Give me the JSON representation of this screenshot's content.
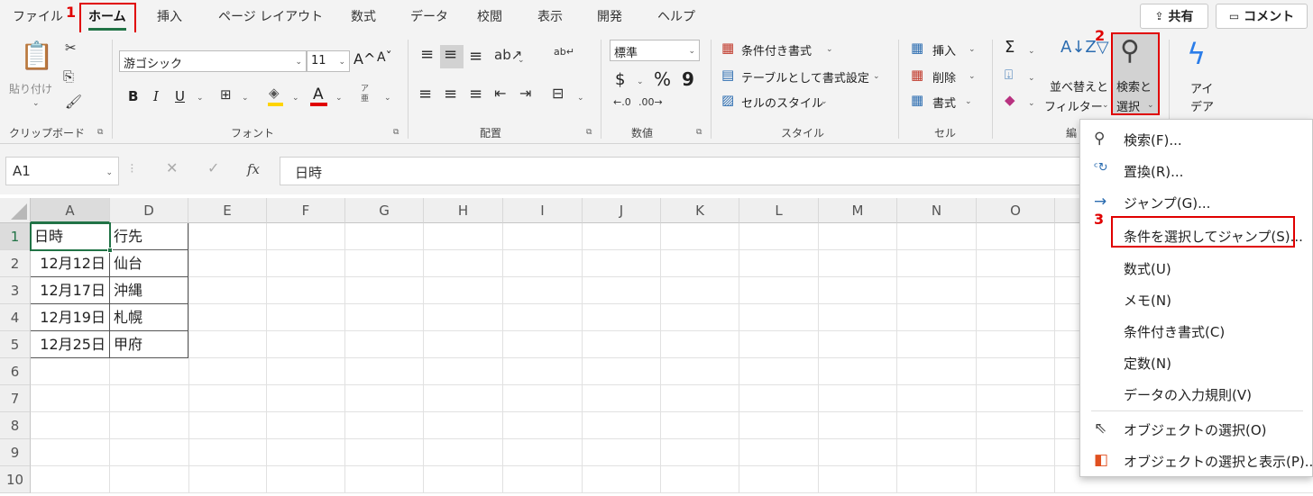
{
  "tabs": [
    {
      "label": "ファイル"
    },
    {
      "label": "ホーム"
    },
    {
      "label": "挿入"
    },
    {
      "label": "ページ レイアウト"
    },
    {
      "label": "数式"
    },
    {
      "label": "データ"
    },
    {
      "label": "校閲"
    },
    {
      "label": "表示"
    },
    {
      "label": "開発"
    },
    {
      "label": "ヘルプ"
    }
  ],
  "share_label": "共有",
  "comment_label": "コメント",
  "steps": {
    "s1": "1",
    "s2": "2",
    "s3": "3"
  },
  "ribbon": {
    "clipboard": {
      "paste": "貼り付け",
      "group": "クリップボード"
    },
    "font": {
      "name": "游ゴシック",
      "size": "11",
      "bold": "B",
      "italic": "I",
      "underline": "U",
      "font_color_glyph": "A",
      "grow": "A^",
      "shrink": "Aˇ",
      "phonetic": "ア亜",
      "group": "フォント"
    },
    "alignment": {
      "group": "配置",
      "wrap": "ab↵"
    },
    "number": {
      "format": "標準",
      "currency": "$",
      "percent": "%",
      "comma": "9",
      "group": "数値"
    },
    "styles": {
      "conditional": "条件付き書式",
      "table": "テーブルとして書式設定",
      "cell_style": "セルのスタイル",
      "group": "スタイル"
    },
    "cells": {
      "insert": "挿入",
      "delete": "削除",
      "format": "書式",
      "group": "セル"
    },
    "editing": {
      "sigma": "Σ",
      "sort_line1": "並べ替えと",
      "sort_line2": "フィルター",
      "find_line1": "検索と",
      "find_line2": "選択",
      "group_partial": "編"
    },
    "ideas": {
      "line1": "アイ",
      "line2": "デア"
    }
  },
  "formula_bar": {
    "name_box": "A1",
    "fx": "fx",
    "content": "日時"
  },
  "columns": [
    "A",
    "D",
    "E",
    "F",
    "G",
    "H",
    "I",
    "J",
    "K",
    "L",
    "M",
    "N",
    "O"
  ],
  "rows": [
    "1",
    "2",
    "3",
    "4",
    "5",
    "6",
    "7",
    "8",
    "9",
    "10"
  ],
  "table": [
    {
      "a": "日時",
      "d": "行先"
    },
    {
      "a": "12月12日",
      "d": "仙台"
    },
    {
      "a": "12月17日",
      "d": "沖縄"
    },
    {
      "a": "12月19日",
      "d": "札幌"
    },
    {
      "a": "12月25日",
      "d": "甲府"
    }
  ],
  "menu": [
    {
      "label": "検索(F)...",
      "icon": "search-icon"
    },
    {
      "label": "置換(R)...",
      "icon": "replace-icon"
    },
    {
      "label": "ジャンプ(G)...",
      "icon": "arrow-right-icon"
    },
    {
      "label": "条件を選択してジャンプ(S)...",
      "icon": ""
    },
    {
      "label": "数式(U)",
      "icon": ""
    },
    {
      "label": "メモ(N)",
      "icon": ""
    },
    {
      "label": "条件付き書式(C)",
      "icon": ""
    },
    {
      "label": "定数(N)",
      "icon": ""
    },
    {
      "label": "データの入力規則(V)",
      "icon": ""
    },
    {
      "label": "オブジェクトの選択(O)",
      "icon": "cursor-icon"
    },
    {
      "label": "オブジェクトの選択と表示(P)...",
      "icon": "selection-pane-icon"
    }
  ],
  "colors": {
    "accent": "#217346",
    "highlight": "#e00000"
  }
}
